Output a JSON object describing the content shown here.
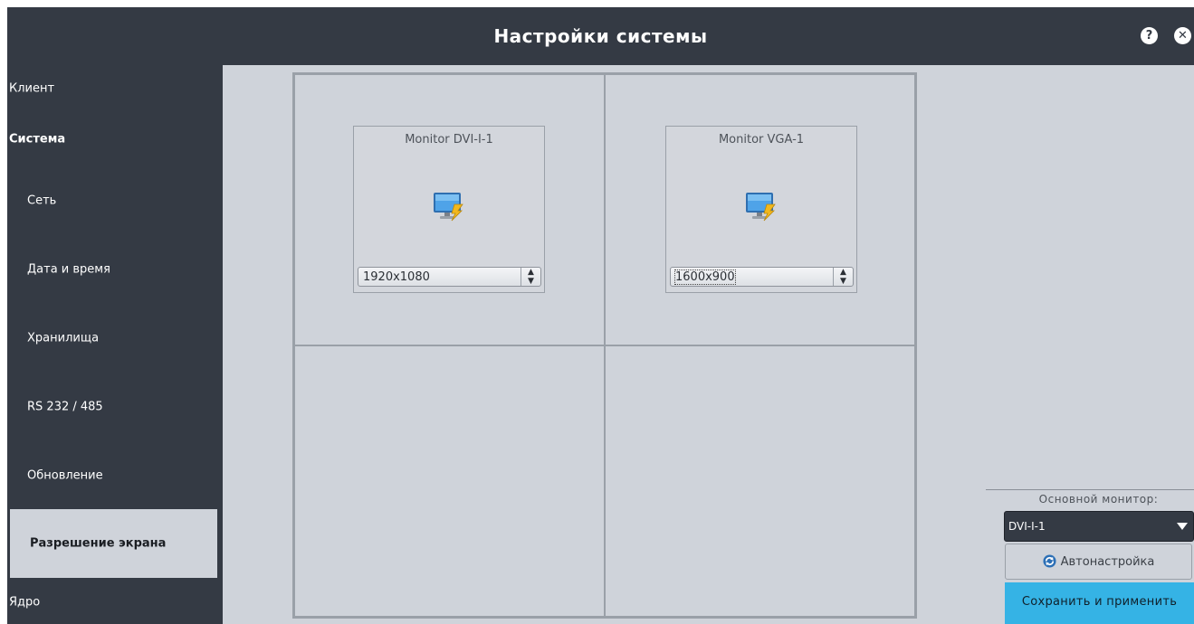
{
  "window": {
    "title": "Настройки системы",
    "help_icon": "help-icon",
    "close_icon": "close-icon"
  },
  "sidebar": {
    "items": [
      {
        "label": "Клиент"
      },
      {
        "label": "Система"
      },
      {
        "label": "Сеть"
      },
      {
        "label": "Дата и время"
      },
      {
        "label": "Хранилища"
      },
      {
        "label": "RS 232 / 485"
      },
      {
        "label": "Обновление"
      },
      {
        "label": "Разрешение экрана",
        "active": true
      },
      {
        "label": "Ядро"
      }
    ]
  },
  "monitors": [
    {
      "name": "Monitor DVI-I-1",
      "resolution": "1920x1080",
      "icon": "monitor-icon"
    },
    {
      "name": "Monitor VGA-1",
      "resolution": "1600x900",
      "icon": "monitor-icon"
    }
  ],
  "right_panel": {
    "primary_label": "Основной монитор:",
    "primary_value": "DVI-I-1",
    "auto_button": "Автонастройка",
    "save_button": "Сохранить и применить"
  },
  "colors": {
    "titlebar": "#343a44",
    "sidebar": "#343a44",
    "content_bg": "#cfd3da",
    "accent": "#35b3e5"
  }
}
